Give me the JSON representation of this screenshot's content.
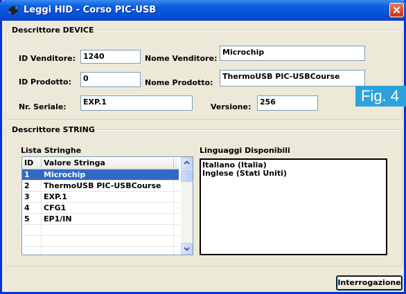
{
  "window": {
    "title": "Leggi HID - Corso PIC-USB"
  },
  "device_group": {
    "legend": "Descrittore DEVICE",
    "id_vendor": {
      "label": "ID Venditore:",
      "value": "1240"
    },
    "vendor_name": {
      "label": "Nome Venditore:",
      "value": "Microchip"
    },
    "id_product": {
      "label": "ID Prodotto:",
      "value": "0"
    },
    "product_name": {
      "label": "Nome Prodotto:",
      "value": "ThermoUSB PIC-USBCourse"
    },
    "serial": {
      "label": "Nr. Seriale:",
      "value": "EXP.1"
    },
    "version": {
      "label": "Versione:",
      "value": "256"
    }
  },
  "fig_label": {
    "text": "Fig. 4",
    "color": "#2aa3dd"
  },
  "string_group": {
    "legend": "Descrittore STRING",
    "list_label": "Lista Stringhe",
    "columns": [
      "ID",
      "Valore Stringa"
    ],
    "rows": [
      {
        "id": "1",
        "value": "Microchip",
        "selected": true
      },
      {
        "id": "2",
        "value": "ThermoUSB PIC-USBCourse"
      },
      {
        "id": "3",
        "value": "EXP.1"
      },
      {
        "id": "4",
        "value": "CFG1"
      },
      {
        "id": "5",
        "value": "EP1/IN"
      }
    ],
    "languages_label": "Linguaggi Disponibili",
    "languages": [
      "Italiano (Italia)",
      "Inglese (Stati Uniti)"
    ]
  },
  "actions": {
    "query_button": "Interrogazione"
  },
  "colors": {
    "title_bar": "#0a5fe0",
    "selection": "#316ac5",
    "close": "#c73411"
  }
}
